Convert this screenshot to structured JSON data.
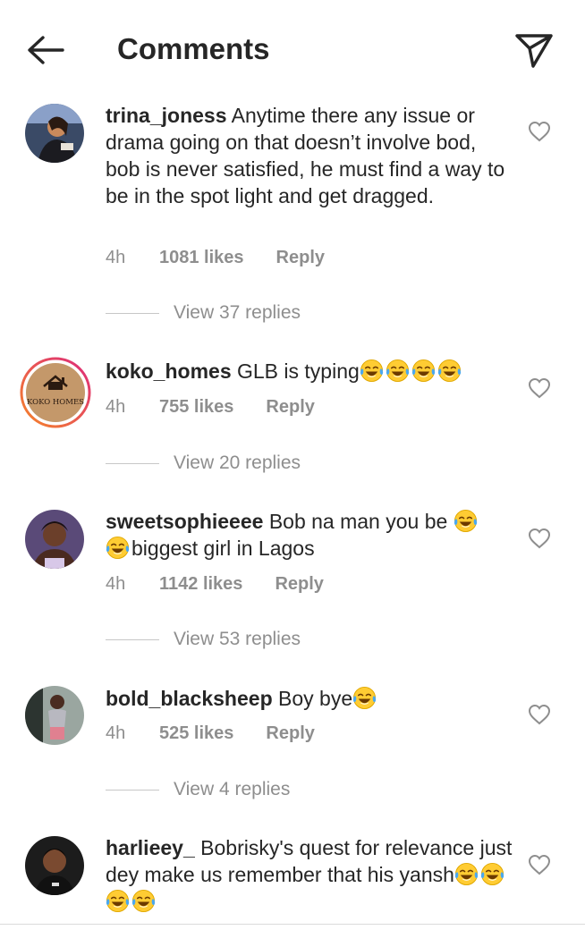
{
  "header": {
    "title": "Comments"
  },
  "comments": [
    {
      "username": "trina_joness",
      "text": "Anytime there any issue or drama going on that doesn’t involve bod, bob is never satisfied, he must find a way to be in the spot light and get dragged.",
      "emoji_count": 0,
      "time": "4h",
      "likes": "1081 likes",
      "reply": "Reply",
      "view_replies": "View 37 replies"
    },
    {
      "username": "koko_homes",
      "text": "GLB is typing",
      "emoji_count": 4,
      "time": "4h",
      "likes": "755 likes",
      "reply": "Reply",
      "view_replies": "View 20 replies",
      "avatar_logo_text": "KOKO HOMES"
    },
    {
      "username": "sweetsophieeee",
      "text_before": "Bob na man you be",
      "text_after": "biggest girl in Lagos",
      "time": "4h",
      "likes": "1142 likes",
      "reply": "Reply",
      "view_replies": "View 53 replies"
    },
    {
      "username": "bold_blacksheep",
      "text": "Boy bye",
      "emoji_count": 1,
      "time": "4h",
      "likes": "525 likes",
      "reply": "Reply",
      "view_replies": "View 4 replies"
    },
    {
      "username": "harlieey_",
      "text": "Bobrisky's quest for relevance just dey make us remember that his yansh",
      "emoji_count": 4
    }
  ],
  "icons": {
    "back": "arrow-left-icon",
    "share": "paper-plane-icon",
    "like": "heart-outline-icon",
    "emoji": "face-with-tears-of-joy"
  },
  "colors": {
    "text": "#262626",
    "secondary": "#8e8e8e",
    "story_ring_start": "#f58529",
    "story_ring_end": "#dd2a7b"
  }
}
